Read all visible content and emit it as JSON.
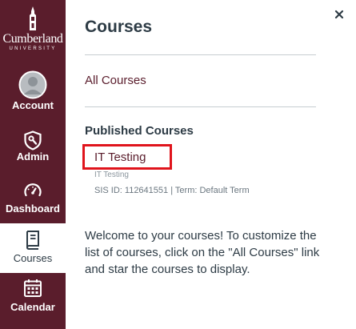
{
  "global_nav": {
    "logo": {
      "name": "Cumberland",
      "subtitle": "UNIVERSITY"
    },
    "items": [
      {
        "label": "Account",
        "icon": "avatar-icon",
        "active": false
      },
      {
        "label": "Admin",
        "icon": "shield-wrench-icon",
        "active": false
      },
      {
        "label": "Dashboard",
        "icon": "speedometer-icon",
        "active": false
      },
      {
        "label": "Courses",
        "icon": "book-icon",
        "active": true
      },
      {
        "label": "Calendar",
        "icon": "calendar-icon",
        "active": false
      }
    ]
  },
  "tray": {
    "title": "Courses",
    "close_icon": "close-icon",
    "all_courses_label": "All Courses",
    "published_heading": "Published Courses",
    "courses": [
      {
        "name": "IT Testing",
        "code": "IT Testing",
        "meta": "SIS ID: 112641551 | Term: Default Term",
        "highlighted": true
      }
    ],
    "welcome_text": "Welcome to your courses! To customize the list of courses, click on the \"All Courses\" link and star the courses to display."
  },
  "colors": {
    "nav_background": "#5a1d2c",
    "link": "#5a1d2c",
    "text": "#2d3b45",
    "highlight_border": "#e0141c"
  }
}
